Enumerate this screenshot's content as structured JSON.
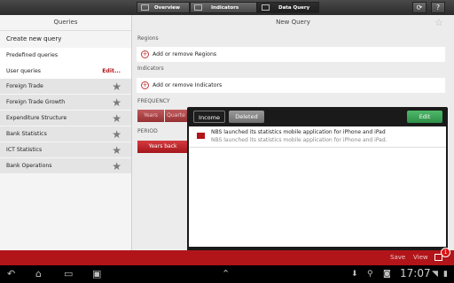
{
  "top_tabs": [
    {
      "label": "Overview",
      "icon": "overview-icon"
    },
    {
      "label": "Indicators",
      "icon": "indicators-icon"
    },
    {
      "label": "Data Query",
      "icon": "data-query-icon"
    }
  ],
  "top_actions": {
    "refresh_icon": "refresh-icon",
    "help_symbol": "?"
  },
  "left_panel": {
    "header": "Queries",
    "create": "Create new query",
    "predefined": "Predefined queries",
    "user_queries": "User queries",
    "edit": "Edit...",
    "items": [
      "Foreign Trade",
      "Foreign Trade Growth",
      "Expenditure Structure",
      "Bank Statistics",
      "ICT Statistics",
      "Bank Operations"
    ]
  },
  "main": {
    "header": "New Query",
    "regions_label": "Regions",
    "regions_add": "Add or remove Regions",
    "indicators_label": "Indicators",
    "indicators_add": "Add or remove Indicators",
    "frequency_label": "FREQUENCY",
    "frequency_options": [
      "Years",
      "Quarte"
    ],
    "period_label": "PERIOD",
    "period_value": "Years back"
  },
  "popup": {
    "tabs": [
      "Income",
      "Deleted"
    ],
    "edit": "Edit",
    "messages": [
      {
        "title": "NBS launched its statistics mobile application for iPhone and iPad",
        "body": "NBS launched its statistics mobile application for iPhone and iPad."
      }
    ]
  },
  "bottom_bar": {
    "save": "Save",
    "view": "View",
    "badge": "1"
  },
  "system_bar": {
    "time": "17:07"
  },
  "colors": {
    "accent_red": "#b1151a",
    "edit_green": "#3fa45a"
  }
}
